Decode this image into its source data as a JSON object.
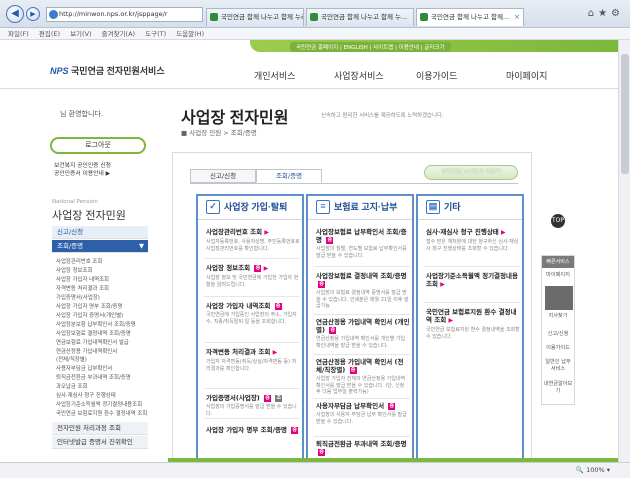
{
  "browser": {
    "address": "http://minwon.nps.or.kr/jsppage/r",
    "tabs": [
      {
        "label": "국민연금 함께 나누고 함께 누리는"
      },
      {
        "label": "국민연금 함께 나누고 함께 누..."
      },
      {
        "label": "국민연금 함께 나누고 함께..."
      }
    ],
    "menu": [
      "파일(F)",
      "편집(E)",
      "보기(V)",
      "즐겨찾기(A)",
      "도구(T)",
      "도움말(H)"
    ],
    "zoom": "100%"
  },
  "header": {
    "util_links": "국민연금 홈페이지 | ENGLISH | 사이트맵 | 이용안내 | 글자크기",
    "logo_mark": "NPS",
    "logo_text": "국민연금 전자민원서비스",
    "gnb": [
      "개인서비스",
      "사업장서비스",
      "이용가이드",
      "마이페이지"
    ]
  },
  "left": {
    "welcome": "님 환영합니다.",
    "logout": "로그아웃",
    "links": [
      "보건복지 공인인증 신청",
      "공인인증서 이용안내 ▶"
    ],
    "section_en": "National Pension",
    "section_title": "사업장 전자민원",
    "nav": [
      {
        "label": "신고/신청"
      },
      {
        "label": "조회/증명"
      }
    ],
    "subs": [
      "사업장관리번호 조회",
      "사업장 정보조회",
      "사업장 가입자 내역조회",
      "자격변동 처리결과 조회",
      "가입증명서(사업장)",
      "사업장 가입자 명부 조회/증명",
      "사업장 가입자 증명서(개인별)",
      "사업장분보험 납부확인서 조회/증명",
      "사업장보험료 결정내역 조회/증명",
      "연금보험료 가입내역확인서 발급",
      "연금산정용 가입내역확인서",
      "(전체/직장별)",
      "사용자부담금 납부확인서",
      "퇴직금전환금 부과내역 조회/증명",
      "과오납금 조회",
      "심사·재심사 청구 진행상태",
      "사업장기준소득월액 정기결정내용조회",
      "국민연금 보험료지원 환수 결정내역 조회"
    ],
    "bottom_nav": [
      "전자민원 처리과정 조회",
      "인터넷발급 증명서 진위확인"
    ]
  },
  "main": {
    "title": "사업장 전자민원",
    "desc": "신속하고 편리한 서비스를 제공하도록 노력하겠습니다.",
    "breadcrumb": "사업장 민원 > 조회/증명",
    "tabs": [
      "신고/신청",
      "조회/증명"
    ],
    "banner": "전자민원 녹색효과 계산기",
    "columns": [
      {
        "title": "사업장 가입·탈퇴",
        "items": [
          {
            "t": "사업장관리번호 조회",
            "d": "사업자등록번호, 사용자성명, 주민등록번호로 사업장관리번호를 확인합니다."
          },
          {
            "t": "사업장 정보조회",
            "d": "사업장 정보 및 국민연금에 가입한 가입자 현황을 알려드립니다."
          },
          {
            "t": "사업장 가입자 내역조회",
            "d": "국민연금에 가입중인 사업장의 주소, 가입자수, 직종/취득탈퇴 일 등을 조회합니다."
          },
          {
            "t": "자격변동 처리결과 조회",
            "d": "가입자 자격변동(취득/상실/자격변동 등) 처리결과를 확인합니다."
          },
          {
            "t": "가입증명서(사업장)",
            "d": "사업장의 가입증명서를 발급 받을 수 있습니다."
          },
          {
            "t": "사업장 가입자 명부 조회/증명",
            "d": ""
          }
        ]
      },
      {
        "title": "보험료 고지·납부",
        "items": [
          {
            "t": "사업장보험료 납부확인서 조회/증명",
            "d": "사업장의 월별, 연도별 보험료 납부확인서를 발급 받을 수 있습니다."
          },
          {
            "t": "사업장보험료 결정내역 조회/증명",
            "d": "사업장의 보험료 결정내역 증명서를 발급 받을 수 있습니다. 인쇄분은 매월 21일 이후 발급가능"
          },
          {
            "t": "연금산정용 가입내역 확인서 (개인별)",
            "d": "연금산정용 가입내역 확인서를 개인별 가입 확인내역을 발급 받을 수 있습니다."
          },
          {
            "t": "연금산정용 가입내역 확인서 (전체/직장별)",
            "d": "사업장 가입자 전체의 연금산정용 가입내역 확인서를 발급 받을 수 있습니다. (단, 신청 후 다음 업무일 출력가능)"
          },
          {
            "t": "사용자부담금 납부확인서",
            "d": "사업장의 사용자 부담금 납부 확인서를 발급 받을 수 있습니다."
          },
          {
            "t": "퇴직금전환금 부과내역 조회/증명",
            "d": ""
          }
        ]
      },
      {
        "title": "기타",
        "items": [
          {
            "t": "심사·재심사 청구 진행상태",
            "d": "접수 받은 재처분에 대한 청구하신 심사·재심사 청구 진행상태를 조회할 수 있습니다."
          },
          {
            "t": "사업장기준소득월액 정기결정내용조회",
            "d": ""
          },
          {
            "t": "국민연금 보험료지원 환수 결정내역 조회",
            "d": "국민연금 보험료지원 환수 결정내역을 조회할 수 있습니다."
          }
        ]
      }
    ]
  },
  "quick": {
    "top": "TOP",
    "head": "빠른서비스",
    "items": [
      "마이페이지",
      "지사찾기",
      "신고/신청",
      "이용가이드",
      "일반인 납부서비스",
      "내연금알아보기"
    ]
  }
}
